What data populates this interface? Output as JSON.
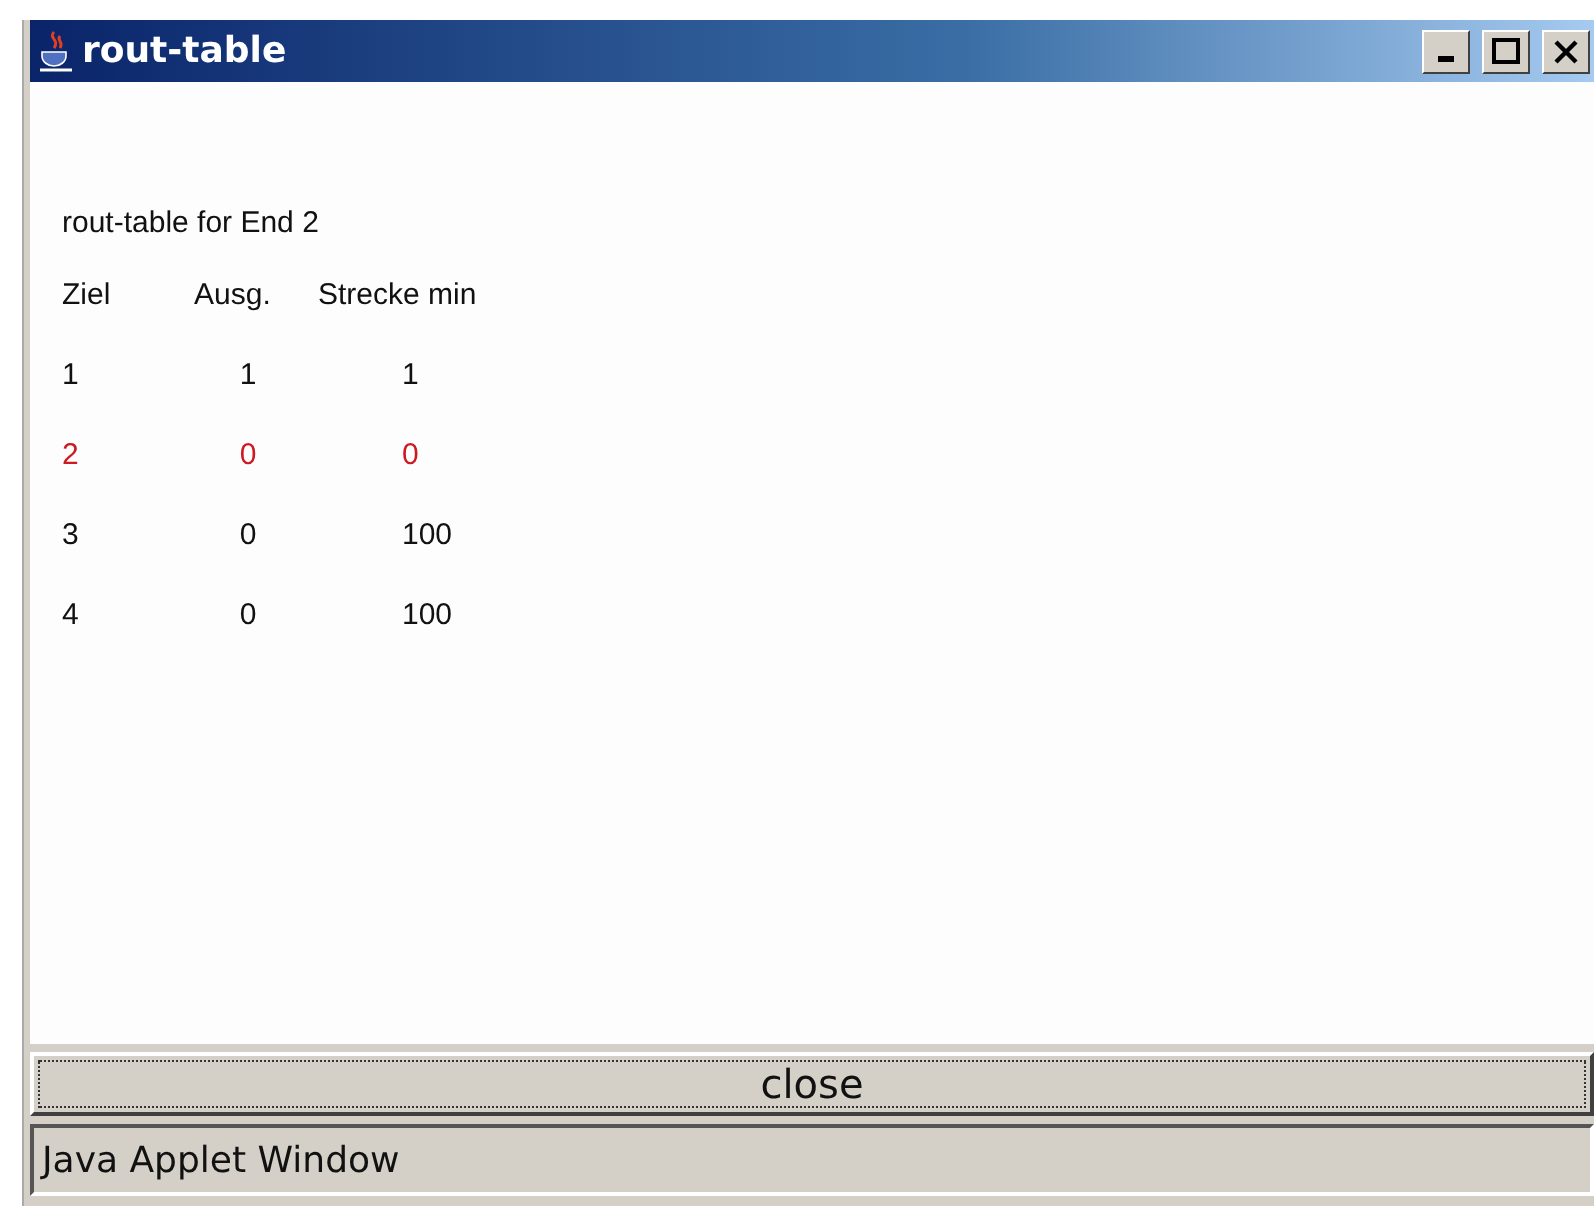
{
  "window": {
    "title": "rout-table"
  },
  "heading": "rout-table for End 2",
  "table": {
    "columns": [
      "Ziel",
      "Ausg.",
      "Strecke min"
    ],
    "rows": [
      {
        "cells": [
          "1",
          "1",
          "1"
        ],
        "highlighted": false
      },
      {
        "cells": [
          "2",
          "0",
          "0"
        ],
        "highlighted": true
      },
      {
        "cells": [
          "3",
          "0",
          "100"
        ],
        "highlighted": false
      },
      {
        "cells": [
          "4",
          "0",
          "100"
        ],
        "highlighted": false
      }
    ]
  },
  "button": "close",
  "status_bar": "Java Applet Window"
}
